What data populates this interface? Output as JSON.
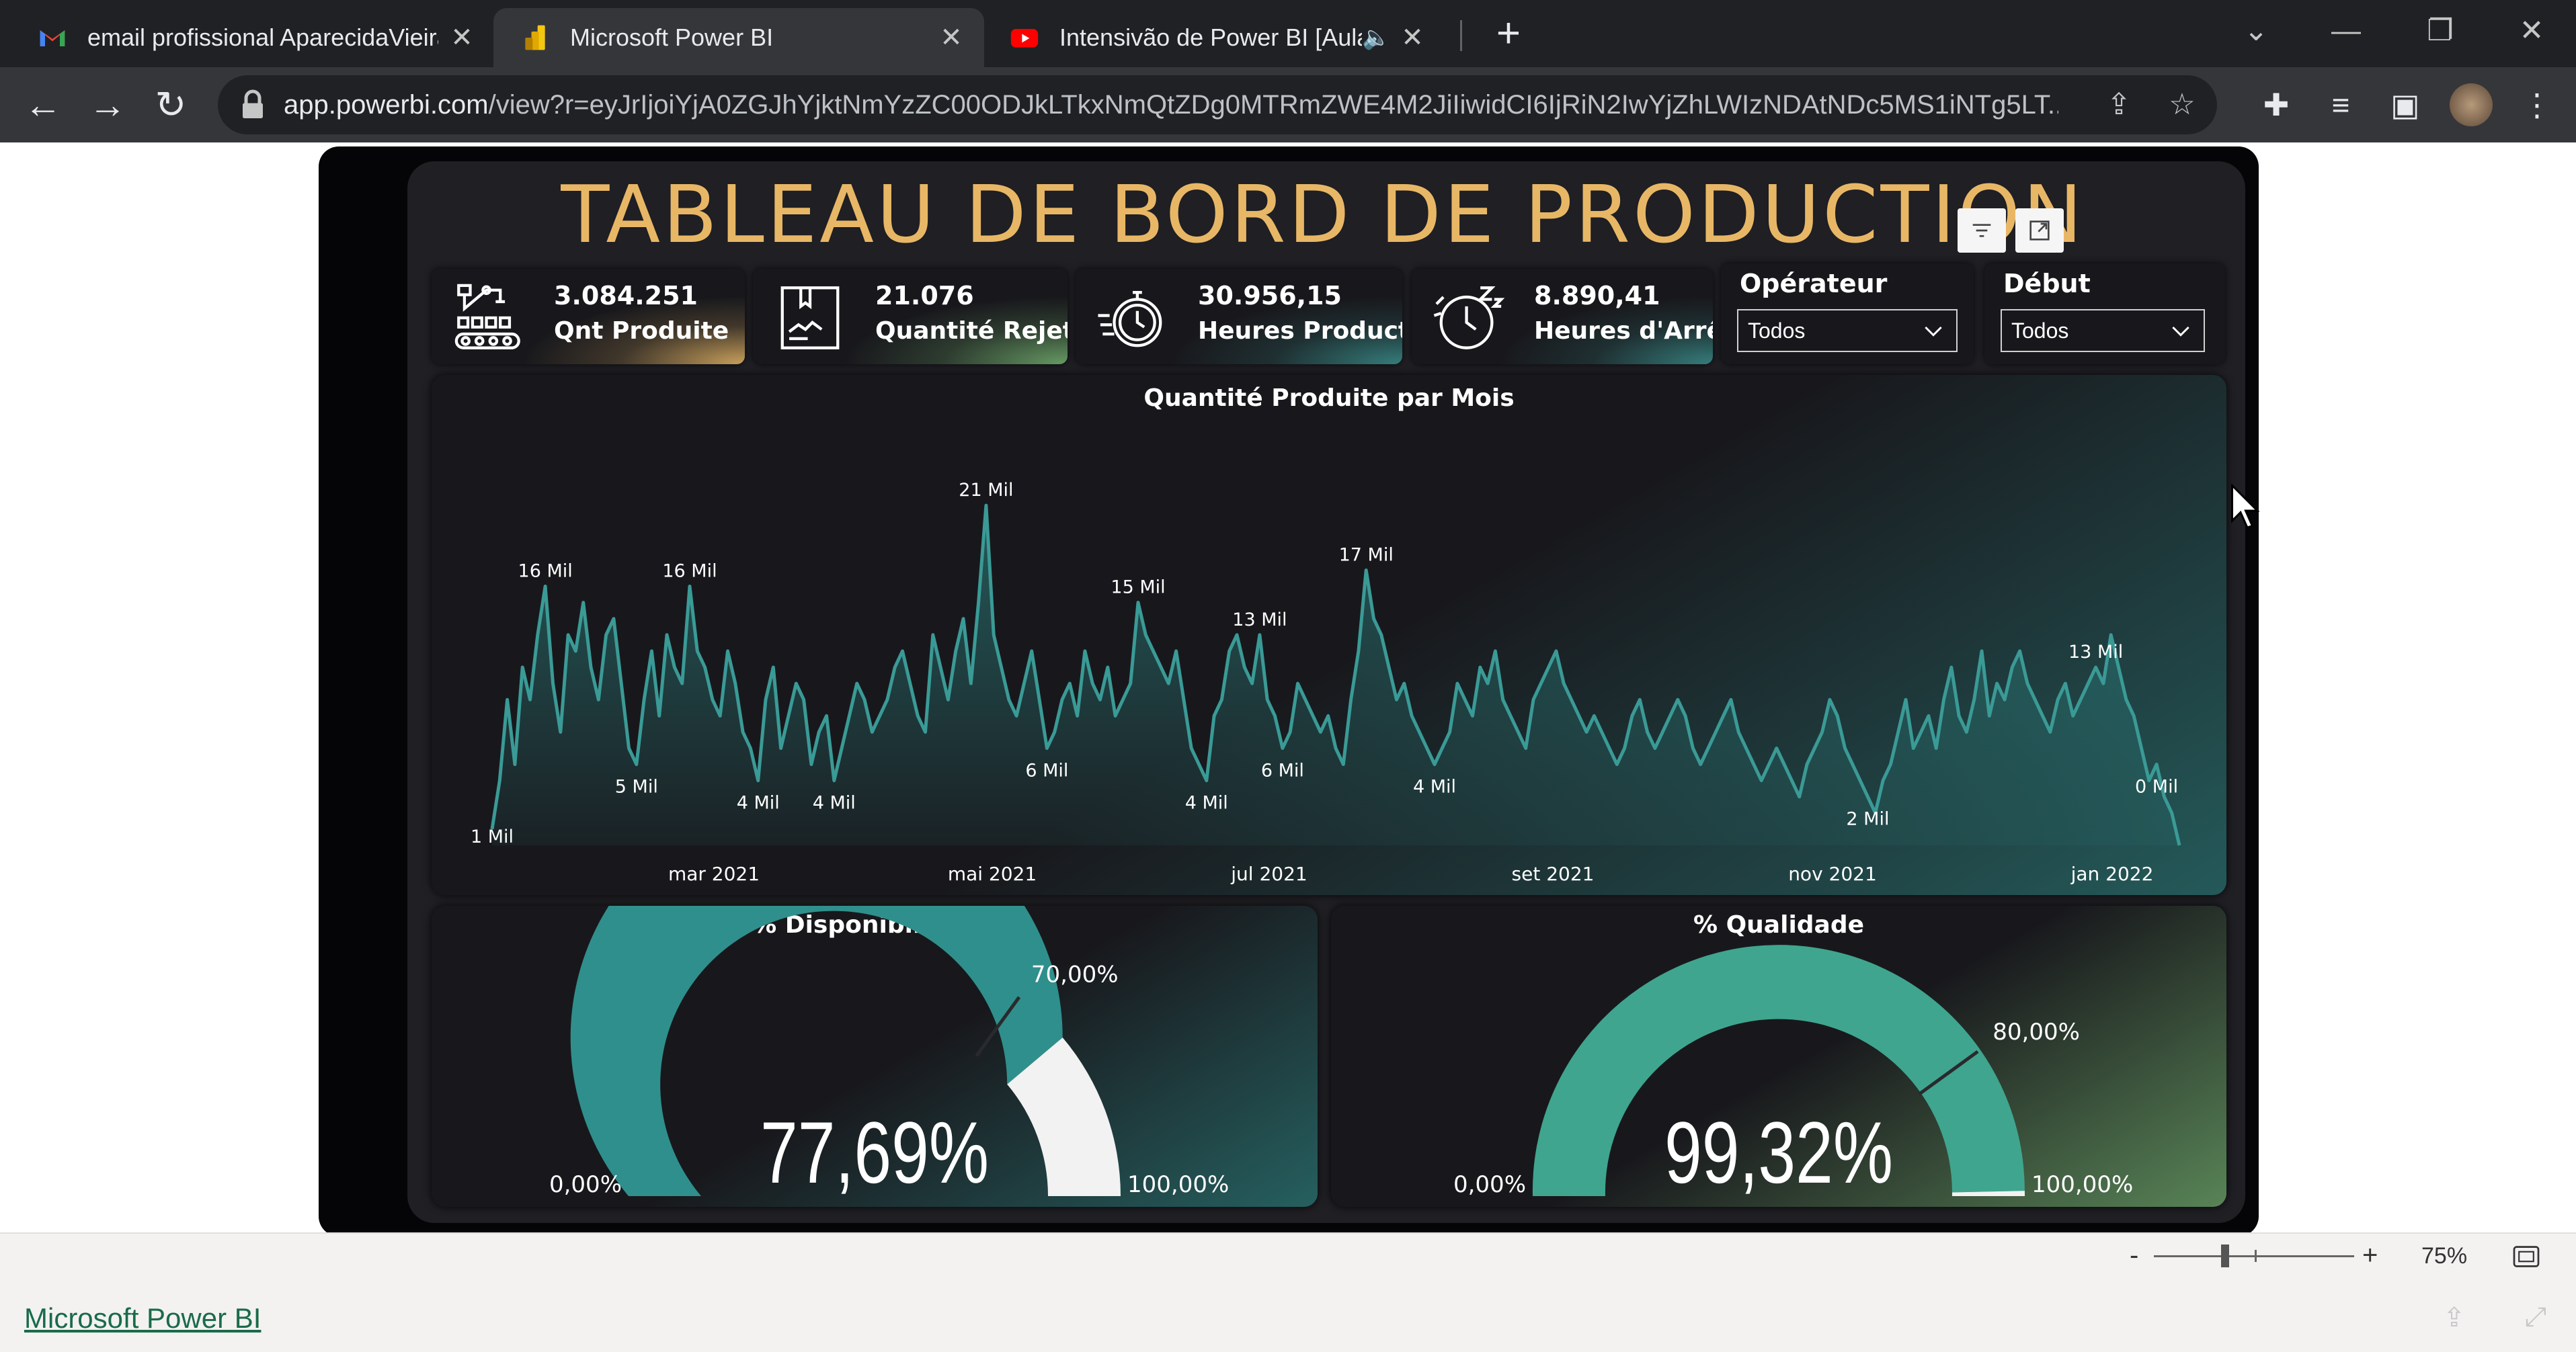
{
  "browser": {
    "tabs": [
      {
        "title": "email profissional AparecidaVieira",
        "icon": "gmail-icon"
      },
      {
        "title": "Microsoft Power BI",
        "icon": "powerbi-icon"
      },
      {
        "title": "Intensivão de Power BI [Aula",
        "icon": "youtube-icon"
      }
    ],
    "url_host": "app.powerbi.com",
    "url_path": "/view?r=eyJrIjoiYjA0ZGJhYjktNmYzZC00ODJkLTkxNmQtZDg0MTRmZWE4M2JiIiwidCI6IjRiN2IwYjZhLWIzNDAtNDc5MS1iNTg5LT..."
  },
  "report": {
    "title": "TABLEAU DE BORD DE PRODUCTION",
    "kpis": [
      {
        "value": "3.084.251",
        "label": "Qnt Produite",
        "icon": "robot-arm-icon",
        "accent": "#e8b766"
      },
      {
        "value": "21.076",
        "label": "Quantité Rejetée",
        "icon": "rejected-box-icon",
        "accent": "#6ea86a"
      },
      {
        "value": "30.956,15",
        "label": "Heures Production",
        "icon": "stopwatch-icon",
        "accent": "#3a8f8c"
      },
      {
        "value": "8.890,41",
        "label": "Heures d'Arrêt",
        "icon": "sleep-clock-icon",
        "accent": "#3a8f8c"
      }
    ],
    "slicers": [
      {
        "title": "Opérateur",
        "value": "Todos"
      },
      {
        "title": "Début",
        "value": "Todos"
      }
    ],
    "line_chart_title": "Quantité Produite par Mois",
    "gauges": [
      {
        "title": "% Disponibilidade",
        "value_label": "77,69%",
        "value": 77.69,
        "target": 70,
        "target_label": "70,00%",
        "min_label": "0,00%",
        "max_label": "100,00%",
        "color": "#2f8f8c"
      },
      {
        "title": "% Qualidade",
        "value_label": "99,32%",
        "value": 99.32,
        "target": 80,
        "target_label": "80,00%",
        "min_label": "0,00%",
        "max_label": "100,00%",
        "color": "#3fa58f"
      }
    ]
  },
  "chart_data": {
    "type": "area",
    "title": "Quantité Produite par Mois",
    "x_ticks": [
      "mar 2021",
      "mai 2021",
      "jul 2021",
      "set 2021",
      "nov 2021",
      "jan 2022"
    ],
    "values": [
      1,
      4,
      9,
      5,
      11,
      9,
      13,
      16,
      10,
      7,
      13,
      12,
      15,
      11,
      9,
      13,
      14,
      10,
      6,
      5,
      9,
      12,
      8,
      13,
      11,
      10,
      16,
      12,
      11,
      9,
      8,
      12,
      10,
      7,
      6,
      4,
      9,
      11,
      6,
      8,
      10,
      9,
      5,
      7,
      8,
      4,
      6,
      8,
      10,
      9,
      7,
      8,
      9,
      11,
      12,
      10,
      8,
      7,
      13,
      11,
      9,
      12,
      14,
      10,
      15,
      21,
      13,
      11,
      9,
      8,
      10,
      12,
      9,
      6,
      7,
      9,
      10,
      8,
      12,
      10,
      9,
      11,
      8,
      9,
      10,
      15,
      13,
      12,
      11,
      10,
      12,
      9,
      6,
      5,
      4,
      8,
      9,
      12,
      13,
      11,
      10,
      13,
      9,
      8,
      6,
      7,
      10,
      9,
      8,
      7,
      8,
      6,
      5,
      9,
      12,
      17,
      14,
      13,
      11,
      9,
      10,
      8,
      7,
      6,
      5,
      6,
      7,
      10,
      9,
      8,
      11,
      10,
      12,
      9,
      8,
      7,
      6,
      9,
      10,
      11,
      12,
      10,
      9,
      8,
      7,
      8,
      7,
      6,
      5,
      6,
      8,
      9,
      7,
      6,
      7,
      8,
      9,
      8,
      6,
      5,
      6,
      7,
      8,
      9,
      7,
      6,
      5,
      4,
      5,
      6,
      5,
      4,
      3,
      5,
      6,
      7,
      9,
      8,
      6,
      5,
      4,
      3,
      2,
      4,
      5,
      7,
      9,
      6,
      7,
      8,
      6,
      9,
      11,
      8,
      7,
      9,
      12,
      8,
      10,
      9,
      11,
      12,
      10,
      9,
      8,
      7,
      9,
      10,
      8,
      9,
      10,
      11,
      10,
      13,
      11,
      9,
      8,
      6,
      4,
      5,
      3,
      2,
      0
    ],
    "data_labels": [
      {
        "index": 0,
        "label": "1 Mil"
      },
      {
        "index": 7,
        "label": "16 Mil"
      },
      {
        "index": 19,
        "label": "5 Mil"
      },
      {
        "index": 26,
        "label": "16 Mil"
      },
      {
        "index": 35,
        "label": "4 Mil"
      },
      {
        "index": 45,
        "label": "4 Mil"
      },
      {
        "index": 65,
        "label": "21 Mil"
      },
      {
        "index": 73,
        "label": "6 Mil"
      },
      {
        "index": 85,
        "label": "15 Mil"
      },
      {
        "index": 94,
        "label": "4 Mil"
      },
      {
        "index": 101,
        "label": "13 Mil"
      },
      {
        "index": 104,
        "label": "6 Mil"
      },
      {
        "index": 115,
        "label": "17 Mil"
      },
      {
        "index": 124,
        "label": "4 Mil"
      },
      {
        "index": 181,
        "label": "2 Mil"
      },
      {
        "index": 211,
        "label": "13 Mil"
      },
      {
        "index": 219,
        "label": "0 Mil"
      }
    ],
    "ylim": [
      0,
      22
    ]
  },
  "status": {
    "zoom_minus": "-",
    "zoom_plus": "+",
    "zoom": "75%",
    "footer_link": "Microsoft Power BI",
    "colors": {
      "chart_fill": "#2f8f8c",
      "title": "#e8b766"
    }
  }
}
